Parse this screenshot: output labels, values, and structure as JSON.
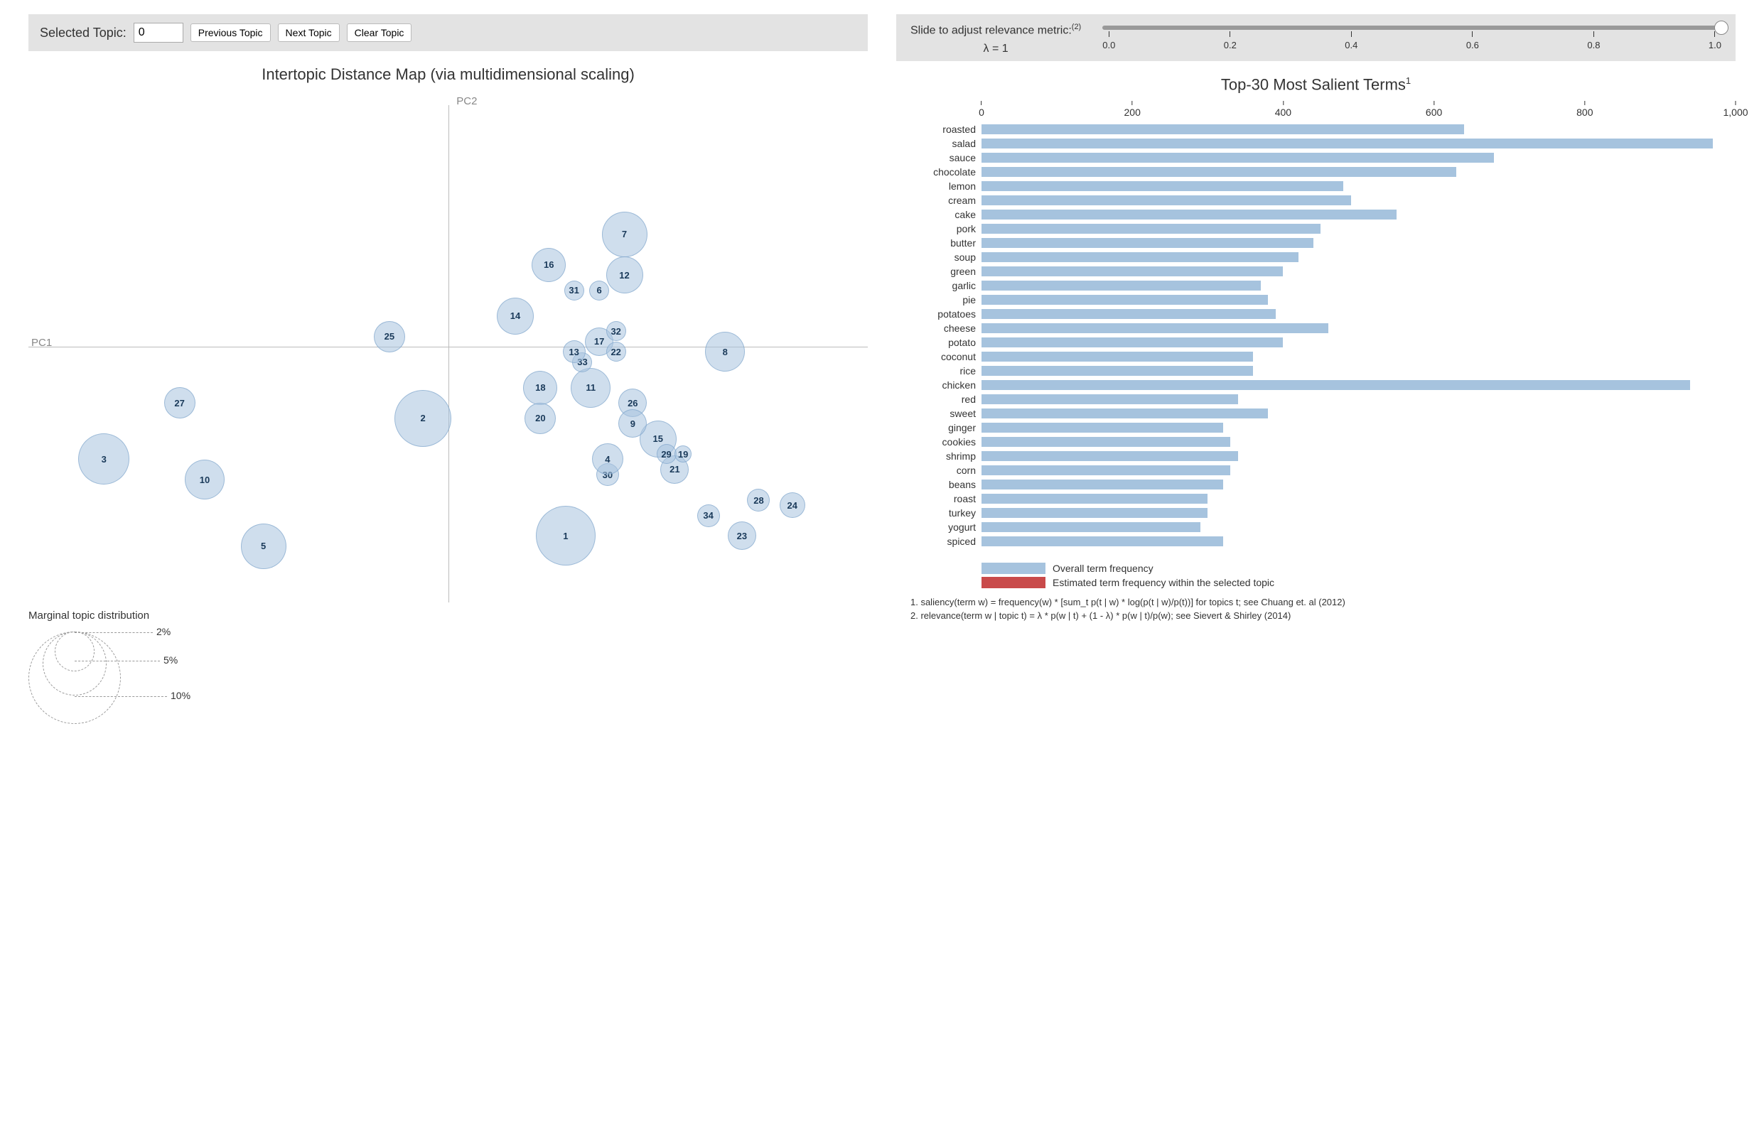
{
  "toolbar": {
    "selected_label": "Selected Topic:",
    "selected_value": "0",
    "prev": "Previous Topic",
    "next": "Next Topic",
    "clear": "Clear Topic"
  },
  "slider": {
    "label_line1": "Slide to adjust relevance metric:",
    "label_sup": "(2)",
    "lambda_label": "λ = 1",
    "ticks": [
      "0.0",
      "0.2",
      "0.4",
      "0.6",
      "0.8",
      "1.0"
    ],
    "value_pct": 100
  },
  "scatter": {
    "title": "Intertopic Distance Map (via multidimensional scaling)",
    "x_label": "PC1",
    "y_label": "PC2",
    "legend_title": "Marginal topic distribution",
    "legend_levels": [
      "2%",
      "5%",
      "10%"
    ],
    "bubbles": [
      {
        "id": "1",
        "x": 64,
        "y": 87,
        "r": 42
      },
      {
        "id": "2",
        "x": 47,
        "y": 64,
        "r": 40
      },
      {
        "id": "3",
        "x": 9,
        "y": 72,
        "r": 36
      },
      {
        "id": "5",
        "x": 28,
        "y": 89,
        "r": 32
      },
      {
        "id": "7",
        "x": 71,
        "y": 28,
        "r": 32
      },
      {
        "id": "8",
        "x": 83,
        "y": 51,
        "r": 28
      },
      {
        "id": "10",
        "x": 21,
        "y": 76,
        "r": 28
      },
      {
        "id": "11",
        "x": 67,
        "y": 58,
        "r": 28
      },
      {
        "id": "12",
        "x": 71,
        "y": 36,
        "r": 26
      },
      {
        "id": "14",
        "x": 58,
        "y": 44,
        "r": 26
      },
      {
        "id": "15",
        "x": 75,
        "y": 68,
        "r": 26
      },
      {
        "id": "16",
        "x": 62,
        "y": 34,
        "r": 24
      },
      {
        "id": "17",
        "x": 68,
        "y": 49,
        "r": 20
      },
      {
        "id": "18",
        "x": 61,
        "y": 58,
        "r": 24
      },
      {
        "id": "20",
        "x": 61,
        "y": 64,
        "r": 22
      },
      {
        "id": "21",
        "x": 77,
        "y": 74,
        "r": 20
      },
      {
        "id": "23",
        "x": 85,
        "y": 87,
        "r": 20
      },
      {
        "id": "24",
        "x": 91,
        "y": 81,
        "r": 18
      },
      {
        "id": "25",
        "x": 43,
        "y": 48,
        "r": 22
      },
      {
        "id": "26",
        "x": 72,
        "y": 61,
        "r": 20
      },
      {
        "id": "27",
        "x": 18,
        "y": 61,
        "r": 22
      },
      {
        "id": "28",
        "x": 87,
        "y": 80,
        "r": 16
      },
      {
        "id": "29",
        "x": 76,
        "y": 71,
        "r": 14
      },
      {
        "id": "30",
        "x": 69,
        "y": 75,
        "r": 16
      },
      {
        "id": "31",
        "x": 65,
        "y": 39,
        "r": 14
      },
      {
        "id": "32",
        "x": 70,
        "y": 47,
        "r": 14
      },
      {
        "id": "33",
        "x": 66,
        "y": 53,
        "r": 14
      },
      {
        "id": "34",
        "x": 81,
        "y": 83,
        "r": 16
      },
      {
        "id": "4",
        "x": 69,
        "y": 72,
        "r": 22
      },
      {
        "id": "6",
        "x": 68,
        "y": 39,
        "r": 14
      },
      {
        "id": "9",
        "x": 72,
        "y": 65,
        "r": 20
      },
      {
        "id": "13",
        "x": 65,
        "y": 51,
        "r": 16
      },
      {
        "id": "19",
        "x": 78,
        "y": 71,
        "r": 12
      },
      {
        "id": "22",
        "x": 70,
        "y": 51,
        "r": 14
      }
    ]
  },
  "bars": {
    "title": "Top-30 Most Salient Terms",
    "title_sup": "1",
    "x_max": 1000,
    "x_ticks": [
      "0",
      "200",
      "400",
      "600",
      "800",
      "1,000"
    ],
    "legend_overall": "Overall term frequency",
    "legend_topic": "Estimated term frequency within the selected topic"
  },
  "footnotes": {
    "f1": "1. saliency(term w) = frequency(w) * [sum_t p(t | w) * log(p(t | w)/p(t))] for topics t; see Chuang et. al (2012)",
    "f2": "2. relevance(term w | topic t) = λ * p(w | t) + (1 - λ) * p(w | t)/p(w); see Sievert & Shirley (2014)"
  },
  "chart_data": {
    "type": "bar",
    "title": "Top-30 Most Salient Terms",
    "xlabel": "",
    "ylabel": "",
    "xlim": [
      0,
      1000
    ],
    "categories": [
      "roasted",
      "salad",
      "sauce",
      "chocolate",
      "lemon",
      "cream",
      "cake",
      "pork",
      "butter",
      "soup",
      "green",
      "garlic",
      "pie",
      "potatoes",
      "cheese",
      "potato",
      "coconut",
      "rice",
      "chicken",
      "red",
      "sweet",
      "ginger",
      "cookies",
      "shrimp",
      "corn",
      "beans",
      "roast",
      "turkey",
      "yogurt",
      "spiced"
    ],
    "values": [
      640,
      970,
      680,
      630,
      480,
      490,
      550,
      450,
      440,
      420,
      400,
      370,
      380,
      390,
      460,
      400,
      360,
      360,
      940,
      340,
      380,
      320,
      330,
      340,
      330,
      320,
      300,
      300,
      290,
      320
    ]
  }
}
